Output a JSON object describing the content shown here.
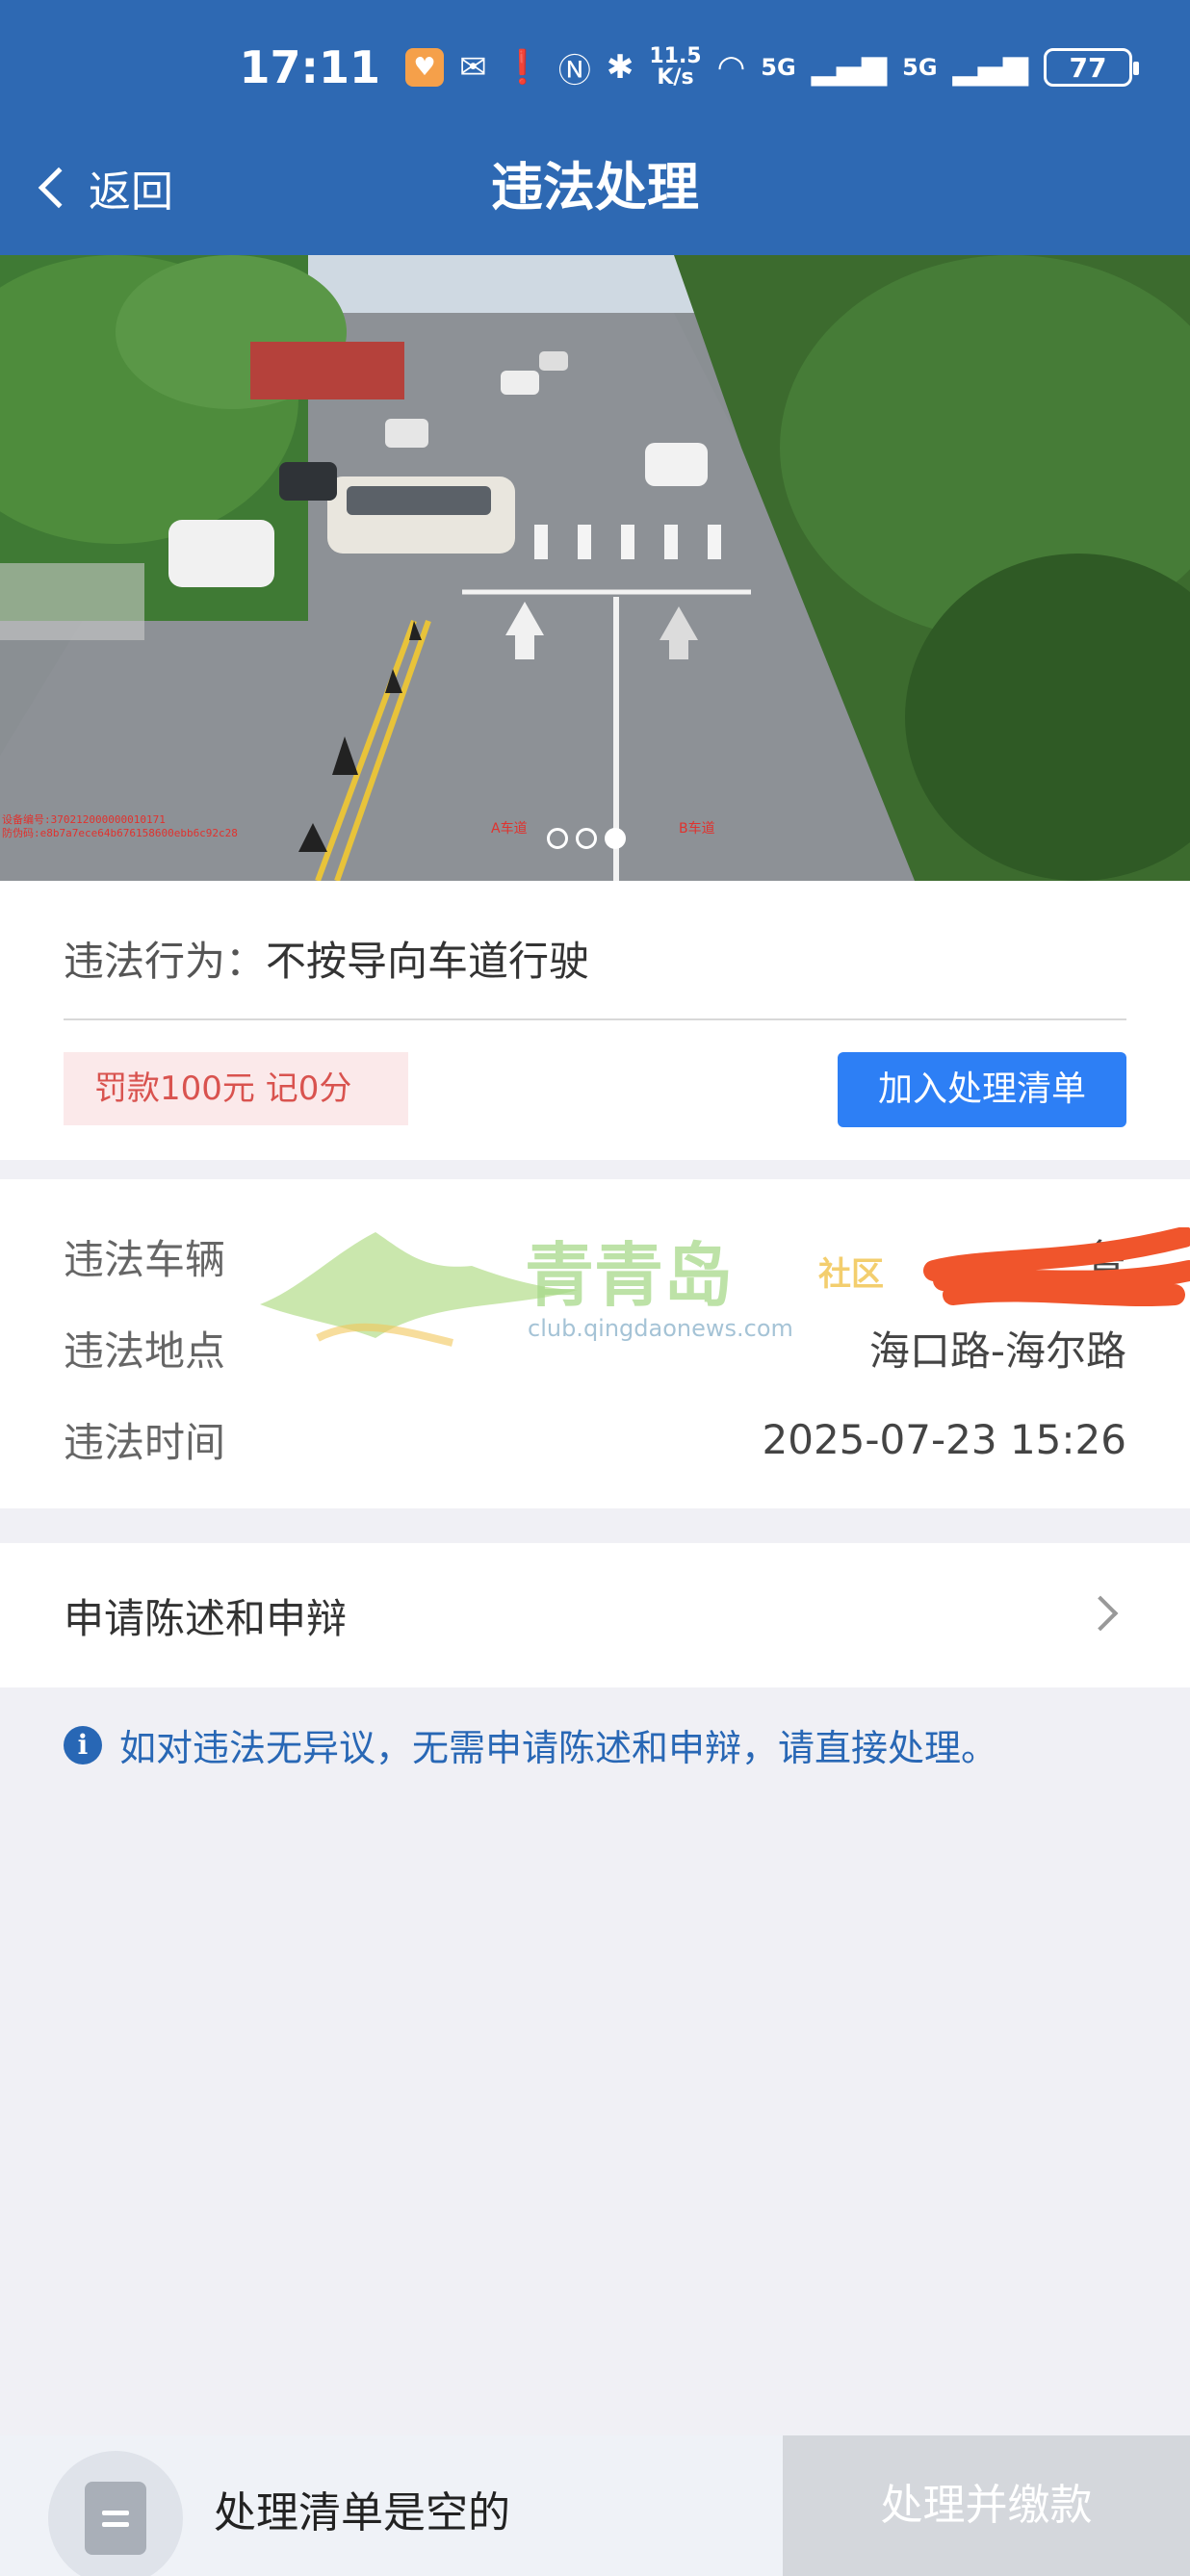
{
  "status_bar": {
    "time": "17:11",
    "net_speed_value": "11.5",
    "net_speed_unit": "K/s",
    "signal1": "5G",
    "signal2": "5G",
    "battery": "77"
  },
  "header": {
    "back_label": "返回",
    "title": "违法处理"
  },
  "photo": {
    "meta_line1": "设备编号:370212000000010171",
    "meta_line2": "防伪码:e8b7a7ece64b676158600ebb6c92c28",
    "label_left": "A车道",
    "label_right": "B车道",
    "carousel_total": 3,
    "carousel_active": 3
  },
  "violation": {
    "behavior_key": "违法行为：",
    "behavior_value": "不按导向车道行驶",
    "fine": "罚款100元 记0分",
    "add_button": "加入处理清单"
  },
  "details": {
    "vehicle_key": "违法车辆",
    "vehicle_value": "鲁",
    "location_key": "违法地点",
    "location_value": "海口路-海尔路",
    "time_key": "违法时间",
    "time_value": "2025-07-23 15:26"
  },
  "watermark": {
    "name": "青青岛",
    "tag": "社区",
    "url": "club.qingdaonews.com"
  },
  "appeal": {
    "label": "申请陈述和申辩"
  },
  "notice": {
    "text": "如对违法无异议，无需申请陈述和申辩，请直接处理。"
  },
  "bottom": {
    "empty_text": "处理清单是空的",
    "pay_button": "处理并缴款"
  },
  "colors": {
    "header_bg": "#2e69b3",
    "primary_button": "#2d7ff5",
    "fine_tag_bg": "#fbe9ea",
    "fine_tag_text": "#d9534f",
    "notice_text": "#2867b5",
    "disabled_button": "#d4d7dc"
  }
}
